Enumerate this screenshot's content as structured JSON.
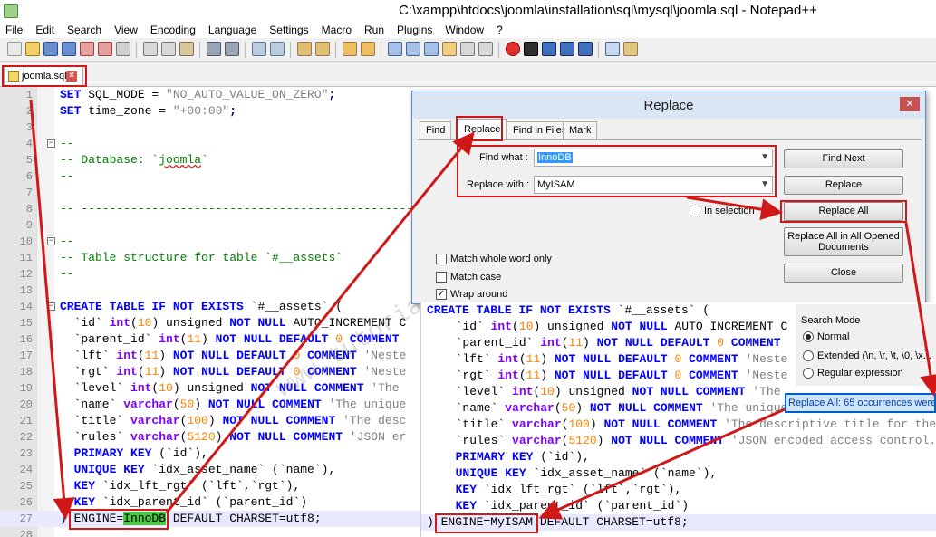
{
  "window": {
    "title": "C:\\xampp\\htdocs\\joomla\\installation\\sql\\mysql\\joomla.sql - Notepad++"
  },
  "menu": [
    "File",
    "Edit",
    "Search",
    "View",
    "Encoding",
    "Language",
    "Settings",
    "Macro",
    "Run",
    "Plugins",
    "Window",
    "?"
  ],
  "tab": {
    "label": "joomla.sql",
    "close": "×"
  },
  "lines": {
    "n": [
      "1",
      "2",
      "3",
      "4",
      "5",
      "6",
      "7",
      "8",
      "9",
      "10",
      "11",
      "12",
      "13",
      "14",
      "15",
      "16",
      "17",
      "18",
      "19",
      "20",
      "21",
      "22",
      "23",
      "24",
      "25",
      "26",
      "27",
      "28"
    ],
    "l1_a": "SET",
    "l1_b": " SQL_MODE = ",
    "l1_c": "\"NO_AUTO_VALUE_ON_ZERO\"",
    "l1_d": ";",
    "l2_a": "SET",
    "l2_b": " time_zone = ",
    "l2_c": "\"+00:00\"",
    "l2_d": ";",
    "l4": "--",
    "l5_a": "-- Database: `",
    "l5_b": "joomla",
    "l5_c": "`",
    "l6": "--",
    "l8": "-- ---------------------------------------------------",
    "l10": "--",
    "l11": "-- Table structure for table `#__assets`",
    "l12": "--",
    "l14_a": "CREATE TABLE IF NOT EXISTS",
    "l14_b": " `#__assets` (",
    "l15_a": "  `id` ",
    "l15_b": "int",
    "l15_c": "(",
    "l15_d": "10",
    "l15_e": ") unsigned ",
    "l15_f": "NOT NULL",
    "l15_g": " AUTO_INCREMENT C",
    "l16_a": "  `parent_id` ",
    "l16_b": "int",
    "l16_c": "(",
    "l16_d": "11",
    "l16_e": ") ",
    "l16_f": "NOT NULL DEFAULT",
    "l16_g": " 0 ",
    "l16_h": "COMMENT",
    "l17_a": "  `lft` ",
    "l17_b": "int",
    "l17_c": "(",
    "l17_d": "11",
    "l17_e": ") ",
    "l17_f": "NOT NULL DEFAULT",
    "l17_g": " 0 ",
    "l17_h": "COMMENT",
    "l17_i": " 'Neste",
    "l18_a": "  `rgt` ",
    "l18_b": "int",
    "l18_c": "(",
    "l18_d": "11",
    "l18_e": ") ",
    "l18_f": "NOT NULL DEFAULT",
    "l18_g": " 0 ",
    "l18_h": "COMMENT",
    "l18_i": " 'Neste",
    "l19_a": "  `level` ",
    "l19_b": "int",
    "l19_c": "(",
    "l19_d": "10",
    "l19_e": ") unsigned ",
    "l19_f": "NOT NULL COMMENT",
    "l19_g": " 'The",
    "l20_a": "  `name` ",
    "l20_b": "varchar",
    "l20_c": "(",
    "l20_d": "50",
    "l20_e": ") ",
    "l20_f": "NOT NULL COMMENT",
    "l20_g": " 'The unique",
    "l21_a": "  `title` ",
    "l21_b": "varchar",
    "l21_c": "(",
    "l21_d": "100",
    "l21_e": ") ",
    "l21_f": "NOT NULL COMMENT",
    "l21_g": " 'The desc",
    "l22_a": "  `rules` ",
    "l22_b": "varchar",
    "l22_c": "(",
    "l22_d": "5120",
    "l22_e": ") ",
    "l22_f": "NOT NULL COMMENT",
    "l22_g": " 'JSON er",
    "l23_a": "  PRIMARY KEY",
    "l23_b": " (`id`),",
    "l24_a": "  UNIQUE KEY",
    "l24_b": " `idx_asset_name` (`name`),",
    "l25_a": "  KEY",
    "l25_b": " `idx_lft_rgt` (`lft`,`rgt`),",
    "l26_a": "  KEY",
    "l26_b": " `idx_parent_id` (`parent_id`)",
    "l27_a": ") ",
    "l27_b": "ENGINE=",
    "l27_c": "InnoDB",
    "l27_d": " DEFAULT CHARSET=utf8;"
  },
  "dialog": {
    "title": "Replace",
    "close": "✕",
    "tabs": [
      "Find",
      "Replace",
      "Find in Files",
      "Mark"
    ],
    "find_label": "Find what :",
    "find_value": "InnoDB",
    "replace_label": "Replace with :",
    "replace_value": "MyISAM",
    "in_selection": "In selection",
    "btn_find_next": "Find Next",
    "btn_replace": "Replace",
    "btn_replace_all": "Replace All",
    "btn_replace_all_docs_1": "Replace All in All Opened",
    "btn_replace_all_docs_2": "Documents",
    "btn_close": "Close",
    "match_whole": "Match whole word only",
    "match_case": "Match case",
    "wrap_around": "Wrap around",
    "search_mode": "Search Mode",
    "mode_normal": "Normal",
    "mode_extended": "Extended (\\n, \\r, \\t, \\0, \\x...",
    "mode_regex": "Regular expression",
    "status": "Replace All: 65 occurrences were"
  },
  "after": {
    "o14_a": "CREATE TABLE IF NOT EXISTS",
    "o14_b": " `#__assets` (",
    "o15_a": "  `id` ",
    "o15_b": "int",
    "o15_c": "(",
    "o15_d": "10",
    "o15_e": ") unsigned ",
    "o15_f": "NOT NULL",
    "o15_g": " AUTO_INCREMENT C",
    "o16_a": "  `parent_id` ",
    "o16_b": "int",
    "o16_c": "(",
    "o16_d": "11",
    "o16_e": ") ",
    "o16_f": "NOT NULL DEFAULT",
    "o16_g": " 0 ",
    "o16_h": "COMMENT",
    "o17_a": "  `lft` ",
    "o17_b": "int",
    "o17_c": "(",
    "o17_d": "11",
    "o17_e": ") ",
    "o17_f": "NOT NULL DEFAULT",
    "o17_g": " 0 ",
    "o17_h": "COMMENT",
    "o17_i": " 'Neste",
    "o18_a": "  `rgt` ",
    "o18_b": "int",
    "o18_c": "(",
    "o18_d": "11",
    "o18_e": ") ",
    "o18_f": "NOT NULL DEFAULT",
    "o18_g": " 0 ",
    "o18_h": "COMMENT",
    "o18_i": " 'Neste",
    "o19_a": "  `level` ",
    "o19_b": "int",
    "o19_c": "(",
    "o19_d": "10",
    "o19_e": ") unsigned ",
    "o19_f": "NOT NULL COMMENT",
    "o19_g": " 'The",
    "o20_a": "  `name` ",
    "o20_b": "varchar",
    "o20_c": "(",
    "o20_d": "50",
    "o20_e": ") ",
    "o20_f": "NOT NULL COMMENT",
    "o20_g": " 'The unique",
    "o21_a": "  `title` ",
    "o21_b": "varchar",
    "o21_c": "(",
    "o21_d": "100",
    "o21_e": ") ",
    "o21_f": "NOT NULL COMMENT",
    "o21_g": " 'The descriptive title for the",
    "o22_a": "  `rules` ",
    "o22_b": "varchar",
    "o22_c": "(",
    "o22_d": "5120",
    "o22_e": ") ",
    "o22_f": "NOT NULL COMMENT",
    "o22_g": " 'JSON encoded access control.",
    "o23_a": "  PRIMARY KEY",
    "o23_b": " (`id`),",
    "o24_a": "  UNIQUE KEY",
    "o24_b": " `idx_asset_name` (`name`),",
    "o25_a": "  KEY",
    "o25_b": " `idx_lft_rgt` (`lft`,`rgt`),",
    "o26_a": "  KEY",
    "o26_b": " `idx_parent_id` (`parent_id`)",
    "o27_a": ") ",
    "o27_b": "ENGINE=MyISAM",
    "o27_c": " DEFAULT CHARSET=utf8;"
  },
  "watermark": "www.tutorialwahyu.info",
  "colors": {
    "annotation": "#d01818",
    "keyword": "#0000ff",
    "type": "#8000ff",
    "number": "#ff8000",
    "comment": "#008000",
    "string": "#808080",
    "status_bg": "#d0e4fa"
  }
}
